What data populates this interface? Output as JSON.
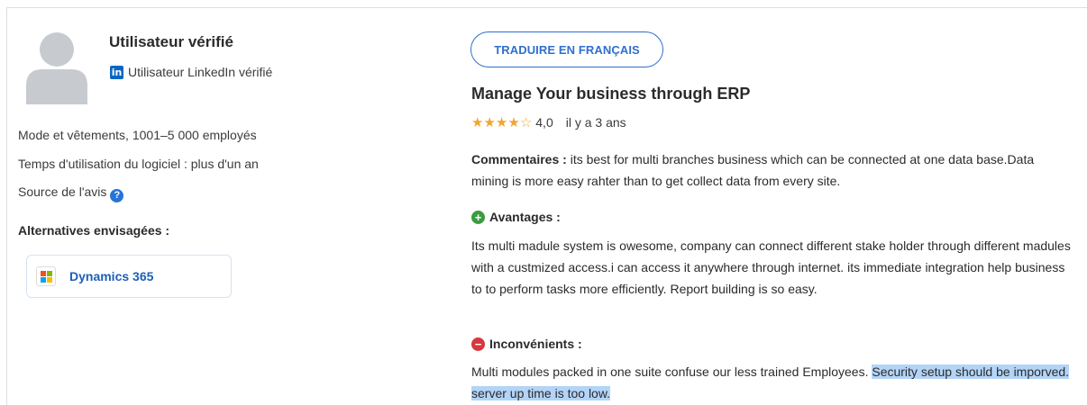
{
  "user": {
    "name": "Utilisateur vérifié",
    "linkedin_badge": "in",
    "linkedin_label": "Utilisateur LinkedIn vérifié"
  },
  "meta": {
    "company": "Mode et vêtements, 1001–5 000 employés",
    "usage": "Temps d'utilisation du logiciel : plus d'un an",
    "source": "Source de l'avis",
    "help_icon": "?"
  },
  "alternatives": {
    "title": "Alternatives envisagées :",
    "items": [
      {
        "name": "Dynamics 365",
        "icon": "microsoft-logo-icon"
      }
    ]
  },
  "review": {
    "translate_label": "TRADUIRE EN FRANÇAIS",
    "title": "Manage Your business through ERP",
    "rating": 4,
    "rating_display": "4,0",
    "age": "il y a 3 ans",
    "comments_label": "Commentaires :",
    "comments_text": " its best for multi branches business which can be connected at one data base.Data mining is more easy rahter than to get collect data from every site.",
    "pros_label": "Avantages :",
    "pros_text": "Its multi madule system is owesome, company can connect different stake holder through different madules with a custmized access.i can access it anywhere through internet. its immediate integration help business to to perform tasks more efficiently. Report building is so easy.",
    "cons_label": "Inconvénients :",
    "cons_text_plain": "Multi modules packed in one suite confuse our less trained Employees. ",
    "cons_text_highlighted": "Security setup should be imporved. server up time is too low."
  },
  "colors": {
    "accent": "#2f6fd0",
    "star": "#f2a531",
    "pros": "#3a9b3f",
    "cons": "#d9363e",
    "highlight": "#b3d4f7"
  }
}
